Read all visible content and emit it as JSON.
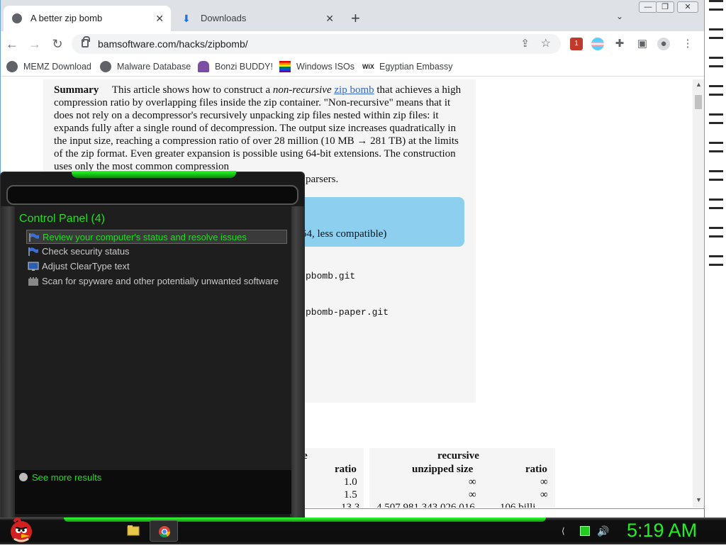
{
  "browser": {
    "tabs": [
      {
        "label": "A better zip bomb",
        "active": true
      },
      {
        "label": "Downloads",
        "active": false
      }
    ],
    "window_controls": [
      "minimize",
      "restore",
      "close"
    ],
    "toolbar": {
      "url": "bamsoftware.com/hacks/zipbomb/"
    },
    "bookmarks": [
      {
        "label": "MEMZ Download",
        "icon": "globe-icon"
      },
      {
        "label": "Malware Database",
        "icon": "globe-icon"
      },
      {
        "label": "Bonzi BUDDY!",
        "icon": "bonzi-icon"
      },
      {
        "label": "Windows ISOs",
        "icon": "rainbow-flag-icon"
      },
      {
        "label": "Egyptian Embassy",
        "icon": "wix-icon"
      }
    ]
  },
  "article": {
    "summary_label": "Summary",
    "summary_text_1": "This article shows how to construct a ",
    "summary_em": "non-recursive",
    "summary_link": "zip bomb",
    "summary_text_2": " that achieves a high compression ratio by overlapping files inside the zip container. \"Non-recursive\" means that it does not rely on a decompressor's recursively unpacking zip files nested within zip files: it expands fully after a single round of decompression. The output size increases quadratically in the input size, reaching a compression ratio of over 28 million (10 MB → 281 TB) at the limits of the zip format. Even greater expansion is possible using 64-bit extensions. The construction uses only the most common compression",
    "summary_tail": "parsers.",
    "bluebox_text": "54, less compatible)",
    "code_1": "pbomb.git",
    "code_2": "pbomb-paper.git",
    "table": {
      "header_left_partial": "e",
      "header_recursive": "recursive",
      "col_ratio": "ratio",
      "col_unzipped": "unzipped size",
      "col_ratio_2": "ratio",
      "rows": [
        {
          "ratio": "1.0",
          "unzipped": "∞",
          "ratio2": "∞"
        },
        {
          "ratio": "1.5",
          "unzipped": "∞",
          "ratio2": "∞"
        }
      ],
      "partial_row": {
        "ratio": "13.3",
        "unzipped": "4,507,981,343,026,016",
        "ratio2": "106 billi"
      }
    }
  },
  "search_panel": {
    "heading": "Control Panel (4)",
    "results": [
      {
        "label": "Review your computer's status and resolve issues",
        "icon": "flag-icon",
        "selected": true
      },
      {
        "label": "Check security status",
        "icon": "flag-icon",
        "selected": false
      },
      {
        "label": "Adjust ClearType text",
        "icon": "monitor-icon",
        "selected": false
      },
      {
        "label": "Scan for spyware and other potentially unwanted software",
        "icon": "castle-icon",
        "selected": false
      }
    ],
    "see_more": "See more results"
  },
  "taskbar": {
    "clock": "5:19 AM",
    "pinned": [
      "explorer-icon",
      "chrome-icon"
    ],
    "tray": [
      "arrow-icon",
      "network-icon",
      "volume-icon"
    ]
  },
  "colors": {
    "accent_green": "#22dd22",
    "chrome_tabstrip": "#dee1e6",
    "link_blue": "#3366cc",
    "info_box": "#8ccfee"
  }
}
